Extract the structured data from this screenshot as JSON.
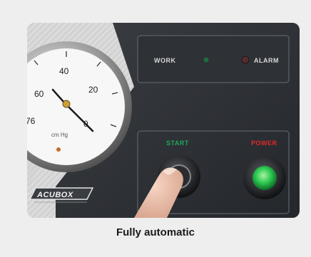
{
  "caption": "Fully automatic",
  "panel": {
    "brand": "ACUBOX",
    "indicators": {
      "work": "WORK",
      "alarm": "ALARM"
    },
    "buttons": {
      "start": "START",
      "power": "POWER"
    }
  },
  "gauge": {
    "unit": "cm Hg",
    "tick_labels": [
      "76",
      "60",
      "40",
      "20",
      "0"
    ]
  },
  "colors": {
    "background": "#eeeeee",
    "panel_dark": "#2c2f33",
    "panel_light": "#d9d9d9",
    "start_label": "#1ea85a",
    "power_label": "#e02b2b",
    "power_lamp": "#2ecc55"
  }
}
